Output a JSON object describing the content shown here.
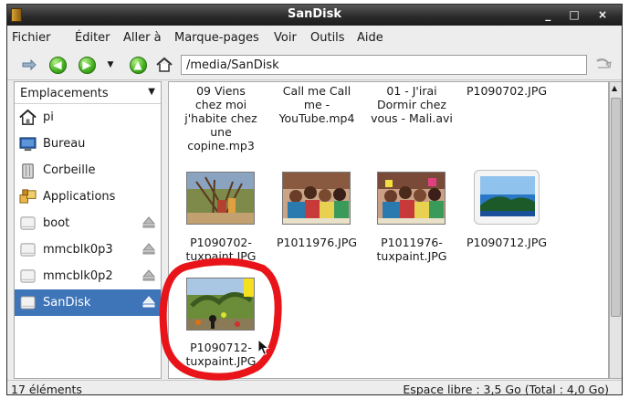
{
  "window": {
    "title": "SanDisk",
    "controls": "_ □ ×"
  },
  "menu": [
    {
      "label": "Fichier"
    },
    {
      "label": "Éditer"
    },
    {
      "label": "Aller à"
    },
    {
      "label": "Marque-pages"
    },
    {
      "label": "Voir"
    },
    {
      "label": "Outils"
    },
    {
      "label": "Aide"
    }
  ],
  "toolbar": {
    "path": "/media/SanDisk"
  },
  "sidebar": {
    "header": "Emplacements",
    "items": [
      {
        "label": "pi",
        "icon": "home-icon"
      },
      {
        "label": "Bureau",
        "icon": "desktop-icon"
      },
      {
        "label": "Corbeille",
        "icon": "trash-icon"
      },
      {
        "label": "Applications",
        "icon": "applications-icon"
      },
      {
        "label": "boot",
        "icon": "drive-icon"
      },
      {
        "label": "mmcblk0p3",
        "icon": "drive-icon"
      },
      {
        "label": "mmcblk0p2",
        "icon": "drive-icon"
      },
      {
        "label": "SanDisk",
        "icon": "drive-icon",
        "selected": true
      }
    ]
  },
  "files": [
    {
      "lines": [
        "09 Viens",
        "chez moi",
        "j'habite chez",
        "une",
        "copine.mp3"
      ]
    },
    {
      "lines": [
        "Call me Call",
        "me -",
        "YouTube.mp4"
      ]
    },
    {
      "lines": [
        "01 - J'irai",
        "Dormir chez",
        "vous - Mali.avi"
      ]
    },
    {
      "lines": [
        "P1090702.JPG"
      ]
    },
    {
      "lines": [
        "P1090702-",
        "tuxpaint.JPG"
      ]
    },
    {
      "lines": [
        "P1011976.JPG"
      ]
    },
    {
      "lines": [
        "P1011976-",
        "tuxpaint.JPG"
      ]
    },
    {
      "lines": [
        "P1090712.JPG"
      ]
    },
    {
      "lines": [
        "P1090712-",
        "tuxpaint.JPG"
      ]
    }
  ],
  "status": {
    "count": "17 éléments",
    "free_space": "Espace libre : 3,5 Go (Total : 4,0 Go)"
  },
  "colors": {
    "selection": "#3e74b8",
    "highlight_circle": "#e8141a"
  }
}
